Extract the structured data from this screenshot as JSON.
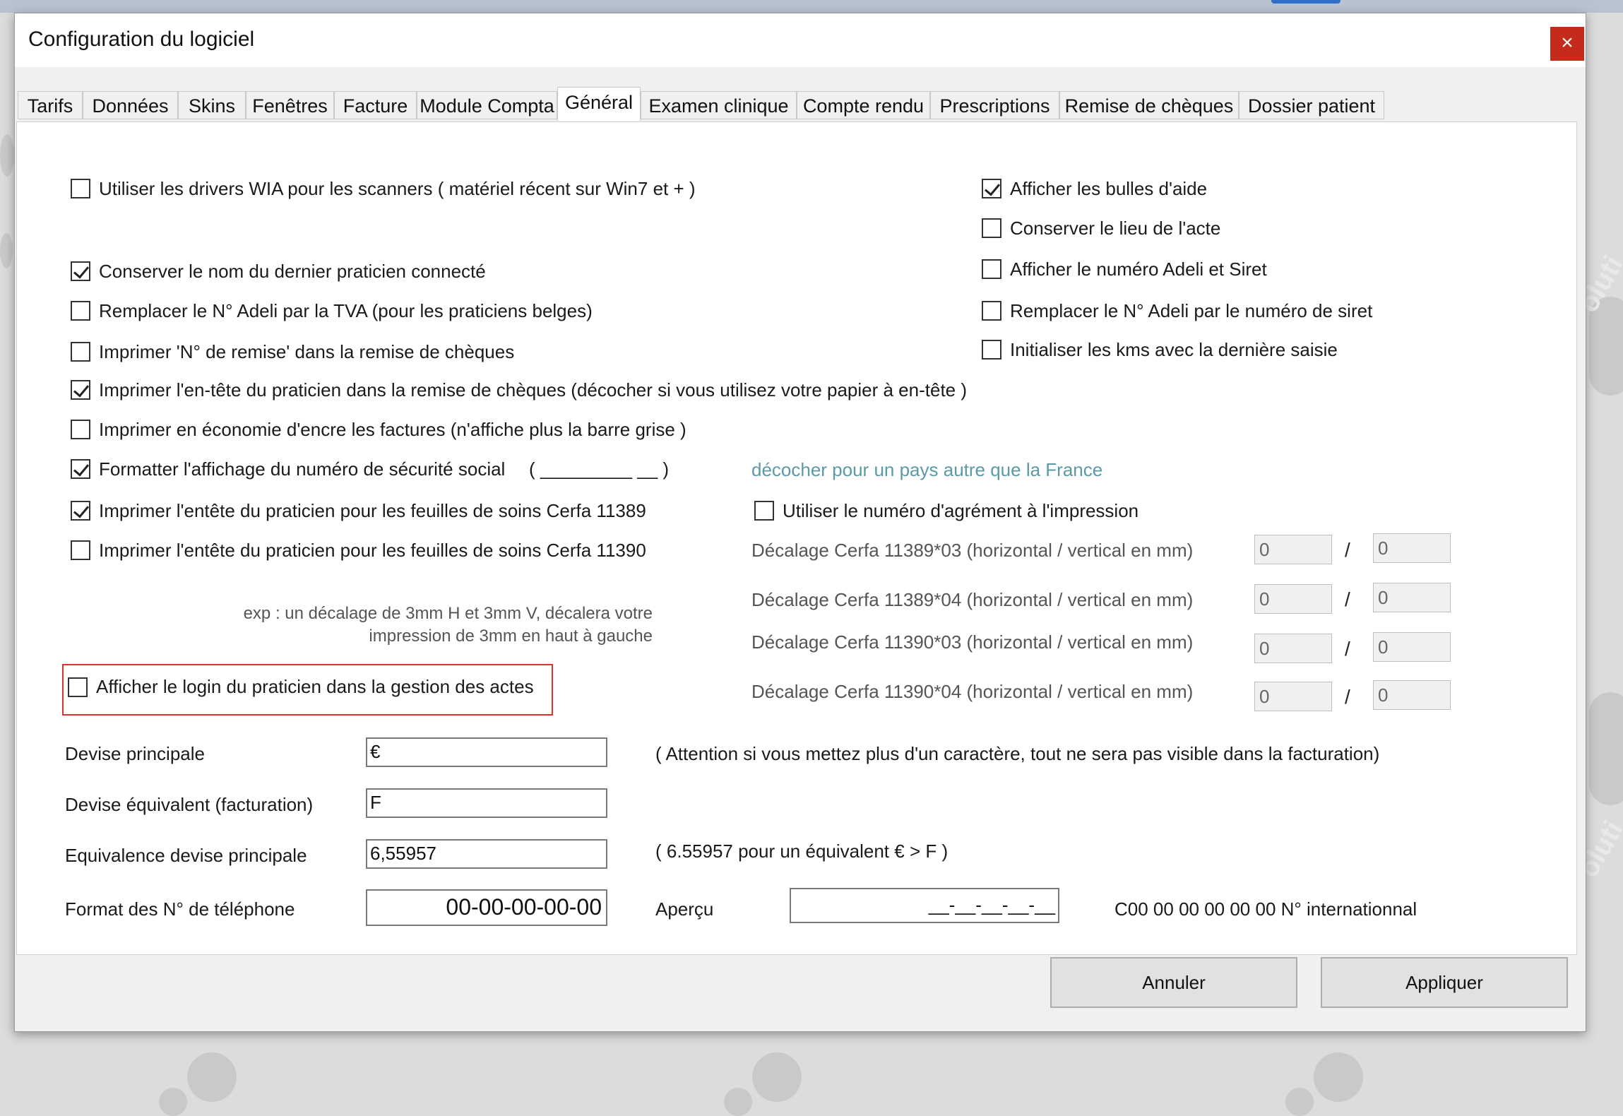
{
  "window": {
    "title": "Configuration du logiciel",
    "close_glyph": "×"
  },
  "tabs": [
    {
      "label": "Tarifs"
    },
    {
      "label": "Données"
    },
    {
      "label": "Skins"
    },
    {
      "label": "Fenêtres"
    },
    {
      "label": "Facture"
    },
    {
      "label": "Module Compta"
    },
    {
      "label": "Général",
      "active": true
    },
    {
      "label": "Examen clinique"
    },
    {
      "label": "Compte rendu"
    },
    {
      "label": "Prescriptions"
    },
    {
      "label": "Remise de chèques"
    },
    {
      "label": "Dossier patient"
    }
  ],
  "left_options": {
    "wia": {
      "label": "Utiliser les drivers WIA pour les scanners ( matériel récent sur Win7 et + )",
      "checked": false
    },
    "keep_last_practitioner": {
      "label": "Conserver le nom du dernier praticien connecté",
      "checked": true
    },
    "adeli_tva": {
      "label": "Remplacer le N° Adeli par la TVA (pour les praticiens belges)",
      "checked": false
    },
    "print_remise_no": {
      "label": "Imprimer 'N° de remise' dans la remise de chèques",
      "checked": false
    },
    "print_header_remise": {
      "label": "Imprimer l'en-tête  du praticien dans la remise de chèques (décocher si vous utilisez votre papier à en-tête )",
      "checked": true
    },
    "ink_economy": {
      "label": "Imprimer en économie d'encre les factures  (n'affiche plus la barre grise )",
      "checked": false
    },
    "format_ssn": {
      "label": "Formatter l'affichage du numéro de sécurité social",
      "checked": true
    },
    "ssn_pattern": "( _________ __ )",
    "ssn_hint": "décocher pour un pays autre que la France",
    "cerfa_11389": {
      "label": "Imprimer l'entête du praticien pour les feuilles de soins Cerfa 11389",
      "checked": true
    },
    "cerfa_11390": {
      "label": "Imprimer l'entête du praticien pour les feuilles de soins Cerfa 11390",
      "checked": false
    },
    "login_actes": {
      "label": "Afficher le login du praticien  dans la gestion des actes",
      "checked": false
    }
  },
  "right_options": {
    "help_bubbles": {
      "label": "Afficher les bulles d'aide",
      "checked": true
    },
    "keep_act_place": {
      "label": "Conserver le lieu de l'acte",
      "checked": false
    },
    "show_adeli_siret": {
      "label": "Afficher le numéro Adeli et Siret",
      "checked": false
    },
    "adeli_siret": {
      "label": "Remplacer le N° Adeli par le numéro de siret",
      "checked": false
    },
    "init_kms": {
      "label": "Initialiser les kms avec la dernière saisie",
      "checked": false
    }
  },
  "agrement": {
    "label": "Utiliser le numéro d'agrément à l'impression",
    "checked": false
  },
  "offsets": [
    {
      "label": "Décalage Cerfa 11389*03 (horizontal / vertical en mm)",
      "h": "0",
      "v": "0"
    },
    {
      "label": "Décalage Cerfa 11389*04 (horizontal / vertical en mm)",
      "h": "0",
      "v": "0"
    },
    {
      "label": "Décalage Cerfa 11390*03 (horizontal / vertical en mm)",
      "h": "0",
      "v": "0"
    },
    {
      "label": "Décalage Cerfa 11390*04 (horizontal / vertical en mm)",
      "h": "0",
      "v": "0"
    }
  ],
  "offset_separator": "/",
  "offset_note": [
    "exp : un décalage de 3mm H et 3mm V, décalera votre",
    "impression de 3mm en haut à gauche"
  ],
  "currency": {
    "main_label": "Devise principale",
    "main_value": "€",
    "main_note": "( Attention si vous mettez plus d'un caractère, tout ne sera pas visible dans la facturation)",
    "equiv_label": "Devise équivalent (facturation)",
    "equiv_value": "F",
    "rate_label": "Equivalence  devise principale",
    "rate_value": "6,55957",
    "rate_note": "( 6.55957 pour un équivalent € > F )"
  },
  "phone": {
    "label": "Format des N° de téléphone",
    "format_value": "00-00-00-00-00",
    "preview_label": "Aperçu",
    "preview_value": "__-__-__-__-__",
    "international": "C00 00 00 00 00 00 N° internationnal"
  },
  "buttons": {
    "cancel": "Annuler",
    "apply": "Appliquer"
  },
  "background": {
    "watermark": "oluti"
  }
}
